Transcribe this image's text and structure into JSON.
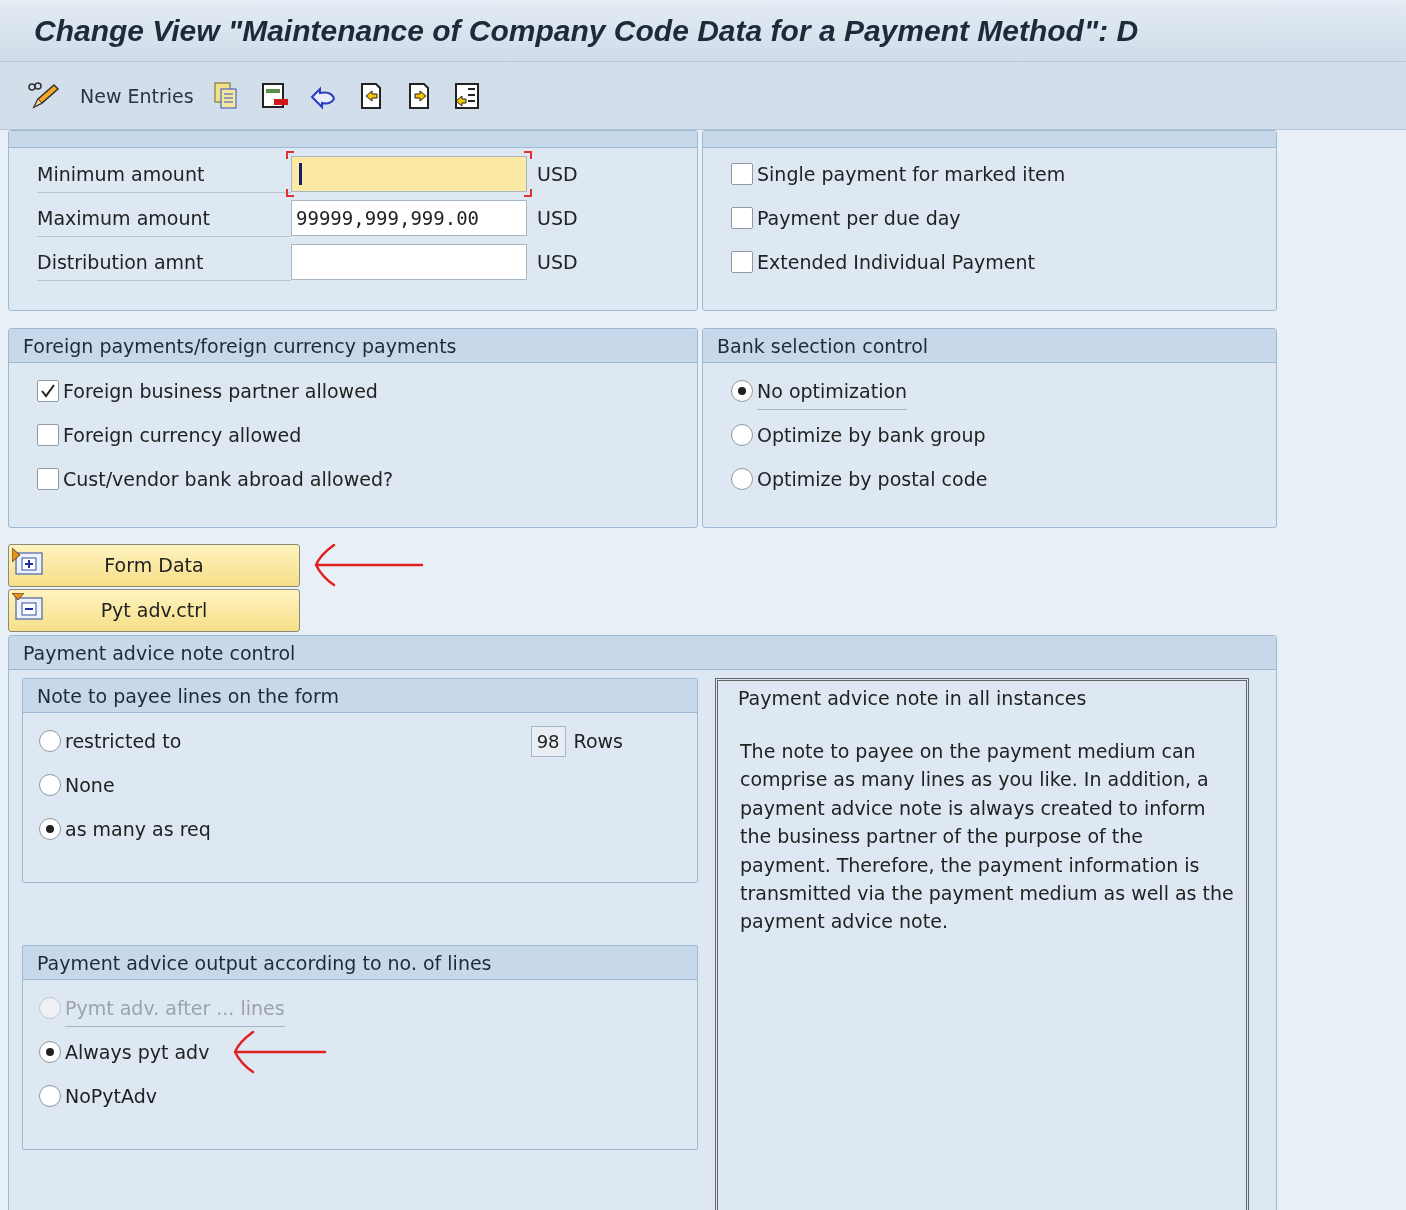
{
  "window": {
    "title": "Change View \"Maintenance of Company Code Data for a Payment Method\": D"
  },
  "toolbar": {
    "new_entries": "New Entries"
  },
  "amount_limits": {
    "rows": [
      {
        "label": "Minimum amount",
        "value": "",
        "currency": "USD",
        "focused": true
      },
      {
        "label": "Maximum amount",
        "value": "99999,999,999.00",
        "currency": "USD",
        "focused": false
      },
      {
        "label": "Distribution amnt",
        "value": "",
        "currency": "USD",
        "focused": false
      }
    ]
  },
  "grouping": {
    "options": [
      {
        "label": "Single payment for marked item",
        "checked": false
      },
      {
        "label": "Payment per due day",
        "checked": false
      },
      {
        "label": "Extended Individual Payment",
        "checked": false
      }
    ]
  },
  "foreign_payments": {
    "title": "Foreign payments/foreign currency payments",
    "options": [
      {
        "label": "Foreign business partner allowed",
        "checked": true
      },
      {
        "label": "Foreign currency allowed",
        "checked": false
      },
      {
        "label": "Cust/vendor bank abroad allowed?",
        "checked": false
      }
    ]
  },
  "bank_selection": {
    "title": "Bank selection control",
    "options": [
      {
        "label": "No optimization",
        "selected": true
      },
      {
        "label": "Optimize by bank group",
        "selected": false
      },
      {
        "label": "Optimize by postal code",
        "selected": false
      }
    ]
  },
  "buttons": [
    {
      "label": "Form Data",
      "expanded": false,
      "arrow": true
    },
    {
      "label": "Pyt adv.ctrl",
      "expanded": true,
      "arrow": false
    }
  ],
  "payment_advice": {
    "title": "Payment advice note control",
    "note_lines": {
      "title": "Note to payee lines on the form",
      "rows_value": "98",
      "rows_label": "Rows",
      "options": [
        {
          "label": "restricted to",
          "selected": false,
          "disabled": false,
          "arrow": false
        },
        {
          "label": "None",
          "selected": false,
          "disabled": false,
          "arrow": false
        },
        {
          "label": "as many as req",
          "selected": true,
          "disabled": false,
          "arrow": false
        }
      ]
    },
    "output": {
      "title": "Payment advice output according to no. of lines",
      "options": [
        {
          "label": "Pymt adv. after ... lines",
          "selected": false,
          "disabled": true,
          "arrow": false
        },
        {
          "label": "Always pyt adv",
          "selected": true,
          "disabled": false,
          "arrow": true
        },
        {
          "label": "NoPytAdv",
          "selected": false,
          "disabled": false,
          "arrow": false
        }
      ]
    },
    "info": {
      "title": "Payment advice note in all instances",
      "text": "The note to payee on the payment medium can comprise as many lines as you like. In addition, a payment advice note is always created to inform the business partner of the purpose of the payment. Therefore, the payment information is transmitted via the payment medium as well as the payment advice note."
    }
  }
}
